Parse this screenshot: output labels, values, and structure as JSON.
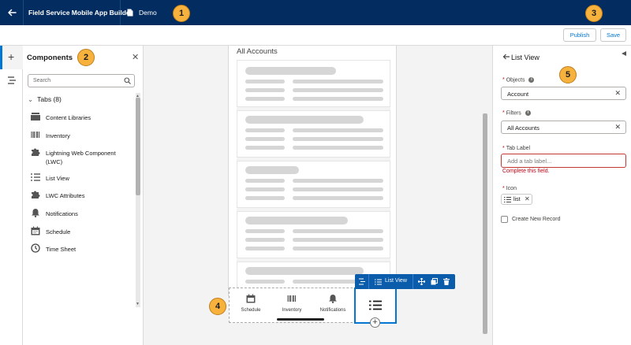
{
  "header": {
    "app_title": "Field Service Mobile App Builder",
    "document_name": "Demo"
  },
  "toolbar": {
    "publish_label": "Publish",
    "save_label": "Save"
  },
  "callouts": [
    "1",
    "2",
    "3",
    "4",
    "5"
  ],
  "components_panel": {
    "title": "Components",
    "search_placeholder": "Search",
    "group_label": "Tabs (8)",
    "items": [
      {
        "label": "Content Libraries",
        "icon": "content-libraries-icon"
      },
      {
        "label": "Inventory",
        "icon": "barcode-icon"
      },
      {
        "label": "Lightning Web Component (LWC)",
        "icon": "puzzle-icon"
      },
      {
        "label": "List View",
        "icon": "list-icon"
      },
      {
        "label": "LWC Attributes",
        "icon": "puzzle-icon"
      },
      {
        "label": "Notifications",
        "icon": "bell-icon"
      },
      {
        "label": "Schedule",
        "icon": "calendar-icon"
      },
      {
        "label": "Time Sheet",
        "icon": "clock-icon"
      }
    ]
  },
  "canvas": {
    "screen_title": "All Accounts",
    "tab_bar": {
      "items": [
        {
          "label": "Schedule",
          "icon": "calendar-icon"
        },
        {
          "label": "Inventory",
          "icon": "barcode-icon"
        },
        {
          "label": "Notifications",
          "icon": "bell-icon"
        }
      ],
      "selected_icon": "list-icon"
    },
    "floating_toolbar": {
      "label": "List View"
    }
  },
  "properties": {
    "title": "List View",
    "objects_label": "Objects",
    "objects_value": "Account",
    "filters_label": "Filters",
    "filters_value": "All Accounts",
    "tab_label_label": "Tab Label",
    "tab_label_placeholder": "Add a tab label...",
    "tab_label_error": "Complete this field.",
    "icon_label": "Icon",
    "icon_value": "list",
    "create_new_record_label": "Create New Record",
    "create_new_record_checked": false
  },
  "colors": {
    "header_bg": "#032d60",
    "accent": "#0176d3",
    "error": "#ba0517",
    "callout": "#f6b23d"
  }
}
